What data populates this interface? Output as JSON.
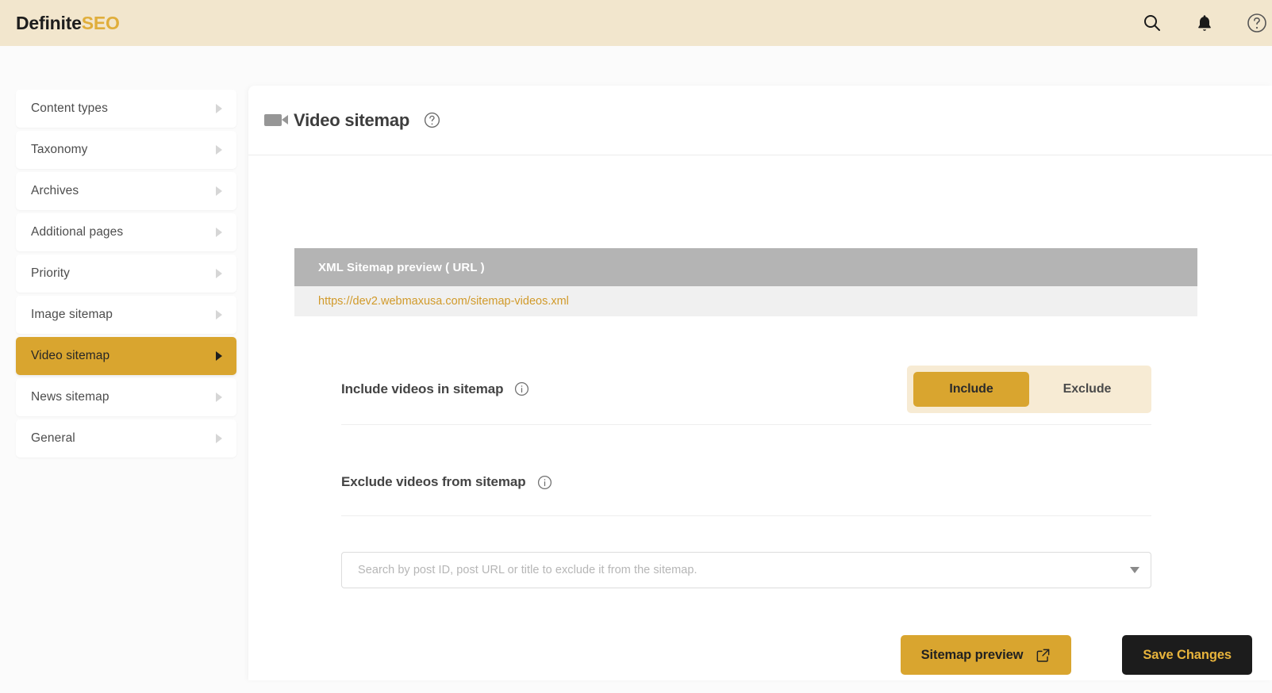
{
  "app": {
    "logo_primary": "Definite",
    "logo_accent": "SEO",
    "accent_color": "#d9a52f",
    "header_bg": "#f2e6cd",
    "page_bg": "#fbfbfb"
  },
  "topbar": {
    "icons": [
      {
        "name": "search-icon",
        "label": "Search"
      },
      {
        "name": "bell-icon",
        "label": "Notifications"
      },
      {
        "name": "help-circle-icon",
        "label": "Help"
      }
    ]
  },
  "sidebar": {
    "items": [
      {
        "label": "Content types",
        "active": false
      },
      {
        "label": "Taxonomy",
        "active": false
      },
      {
        "label": "Archives",
        "active": false
      },
      {
        "label": "Additional pages",
        "active": false
      },
      {
        "label": "Priority",
        "active": false
      },
      {
        "label": "Image sitemap",
        "active": false
      },
      {
        "label": "Video sitemap",
        "active": true
      },
      {
        "label": "News sitemap",
        "active": false
      },
      {
        "label": "General",
        "active": false
      }
    ]
  },
  "panel": {
    "title": "Video sitemap",
    "icon": "video-camera-icon",
    "help_icon": "help-circle-icon"
  },
  "preview": {
    "header_label": "XML Sitemap preview ( URL )",
    "url": "https://dev2.webmaxusa.com/sitemap-videos.xml"
  },
  "settings": {
    "include": {
      "label": "Include videos in sitemap",
      "options": [
        "Include",
        "Exclude"
      ],
      "selected": "Include"
    },
    "exclude": {
      "label": "Exclude videos from sitemap"
    }
  },
  "search": {
    "placeholder": "Search by post ID, post URL or title to exclude it from the sitemap.",
    "value": ""
  },
  "footer": {
    "preview_button": "Sitemap preview",
    "save_button": "Save Changes"
  }
}
